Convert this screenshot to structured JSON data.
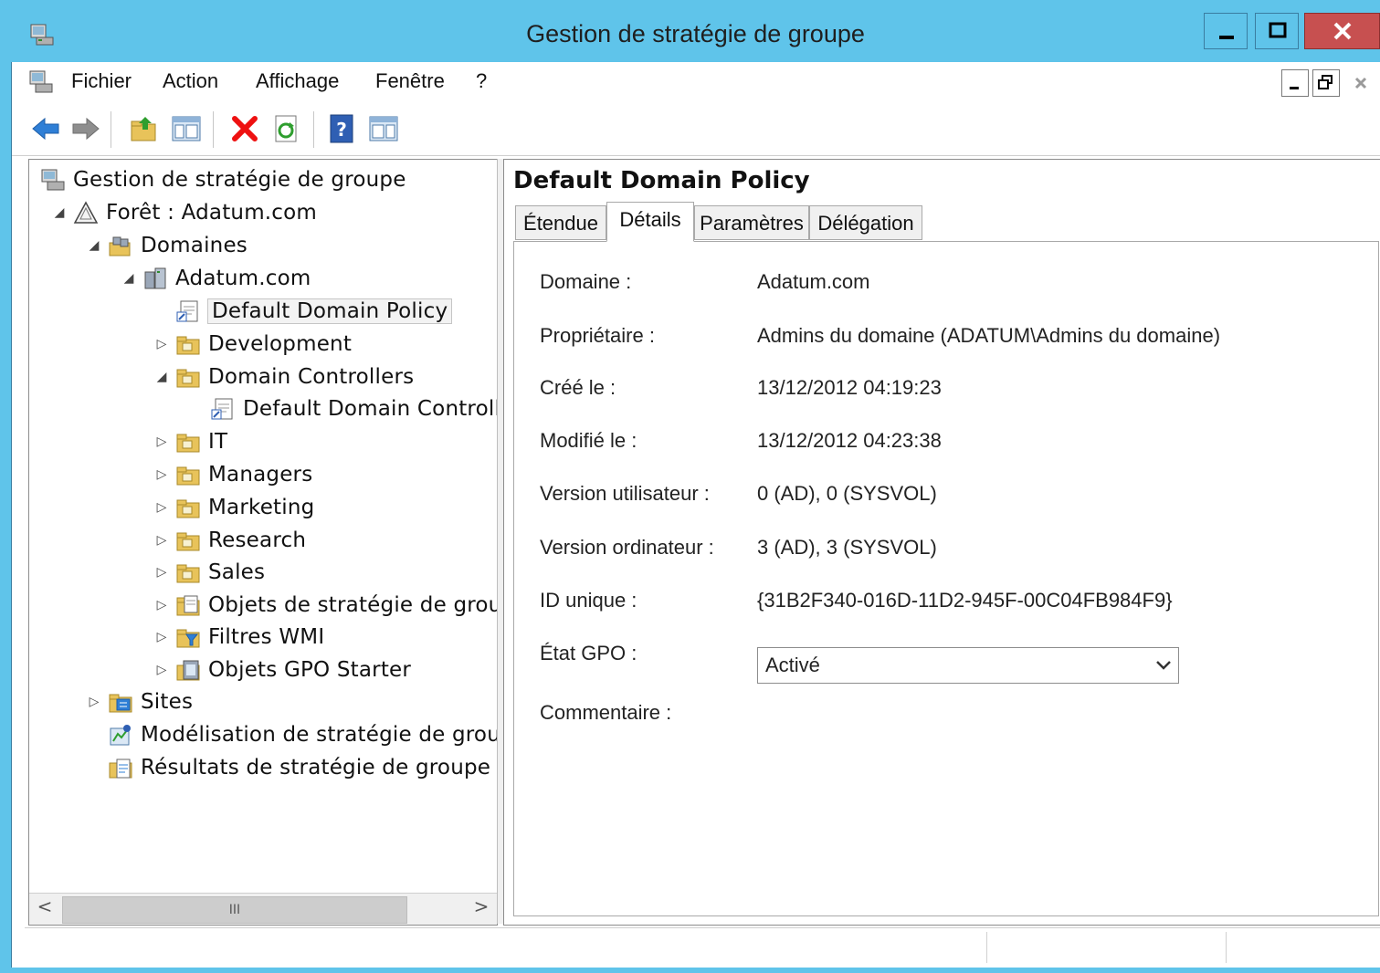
{
  "window": {
    "title": "Gestion de stratégie de groupe",
    "title_bar_color": "#5fc4ea",
    "buttons": [
      "minimize-icon",
      "maximize-icon",
      "close-icon"
    ]
  },
  "menu": {
    "items": [
      "Fichier",
      "Action",
      "Affichage",
      "Fenêtre",
      "?"
    ]
  },
  "toolbar": {
    "buttons": [
      "back-arrow-icon",
      "forward-arrow-icon",
      "up-folder-icon",
      "show-hide-tree-icon",
      "delete-icon",
      "refresh-icon",
      "help-icon",
      "properties-pane-icon"
    ]
  },
  "tree": {
    "items": [
      {
        "label": "Gestion de stratégie de groupe",
        "icon": "console-icon",
        "toggle": ""
      },
      {
        "label": "Forêt : Adatum.com",
        "icon": "forest-icon",
        "toggle": "◢"
      },
      {
        "label": "Domaines",
        "icon": "domains-icon",
        "toggle": "◢"
      },
      {
        "label": "Adatum.com",
        "icon": "domain-icon",
        "toggle": "◢"
      },
      {
        "label": "Default Domain Policy",
        "icon": "gpo-link-icon",
        "toggle": ""
      },
      {
        "label": "Development",
        "icon": "ou-folder-icon",
        "toggle": "▷"
      },
      {
        "label": "Domain Controllers",
        "icon": "ou-folder-icon",
        "toggle": "◢"
      },
      {
        "label": "Default Domain Controller",
        "icon": "gpo-link-icon",
        "toggle": ""
      },
      {
        "label": "IT",
        "icon": "ou-folder-icon",
        "toggle": "▷"
      },
      {
        "label": "Managers",
        "icon": "ou-folder-icon",
        "toggle": "▷"
      },
      {
        "label": "Marketing",
        "icon": "ou-folder-icon",
        "toggle": "▷"
      },
      {
        "label": "Research",
        "icon": "ou-folder-icon",
        "toggle": "▷"
      },
      {
        "label": "Sales",
        "icon": "ou-folder-icon",
        "toggle": "▷"
      },
      {
        "label": "Objets de stratégie de groupe",
        "icon": "gpo-container-icon",
        "toggle": "▷"
      },
      {
        "label": "Filtres WMI",
        "icon": "wmi-filter-icon",
        "toggle": "▷"
      },
      {
        "label": "Objets GPO Starter",
        "icon": "starter-gpo-icon",
        "toggle": "▷"
      },
      {
        "label": "Sites",
        "icon": "sites-icon",
        "toggle": "▷"
      },
      {
        "label": "Modélisation de stratégie de groupe",
        "icon": "modeling-icon",
        "toggle": ""
      },
      {
        "label": "Résultats de stratégie de groupe",
        "icon": "results-icon",
        "toggle": ""
      }
    ],
    "scrollbar": {
      "left": "<",
      "thumb": "III",
      "right": ">"
    }
  },
  "details": {
    "gpo_name": "Default Domain Policy",
    "tabs": [
      "Étendue",
      "Détails",
      "Paramètres",
      "Délégation"
    ],
    "active_tab": "Détails",
    "fields": [
      {
        "label": "Domaine :",
        "value": "Adatum.com"
      },
      {
        "label": "Propriétaire :",
        "value": "Admins du domaine (ADATUM\\Admins du domaine)"
      },
      {
        "label": "Créé le :",
        "value": "13/12/2012 04:19:23"
      },
      {
        "label": "Modifié le :",
        "value": "13/12/2012 04:23:38"
      },
      {
        "label": "Version utilisateur :",
        "value": "0 (AD), 0 (SYSVOL)"
      },
      {
        "label": "Version ordinateur :",
        "value": "3 (AD), 3 (SYSVOL)"
      },
      {
        "label": "ID unique :",
        "value": "{31B2F340-016D-11D2-945F-00C04FB984F9}"
      }
    ],
    "gpo_status_label": "État GPO :",
    "gpo_status_value": "Activé",
    "comment_label": "Commentaire :"
  }
}
